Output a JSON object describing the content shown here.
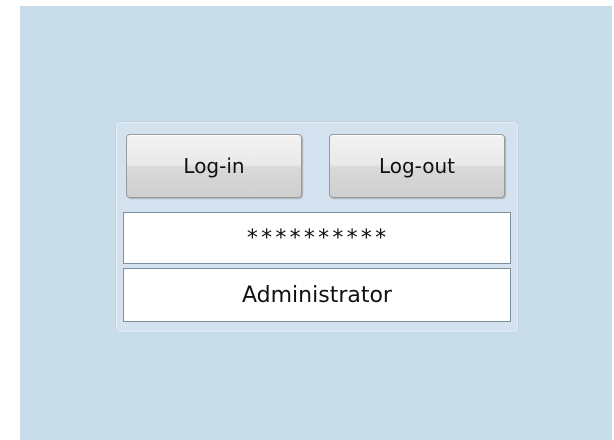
{
  "login_panel": {
    "login_button_label": "Log-in",
    "logout_button_label": "Log-out",
    "password_display": "**********",
    "user_display": "Administrator"
  },
  "colors": {
    "background": "#c9dcea",
    "panel": "#d3e2ee",
    "field": "#ffffff"
  }
}
